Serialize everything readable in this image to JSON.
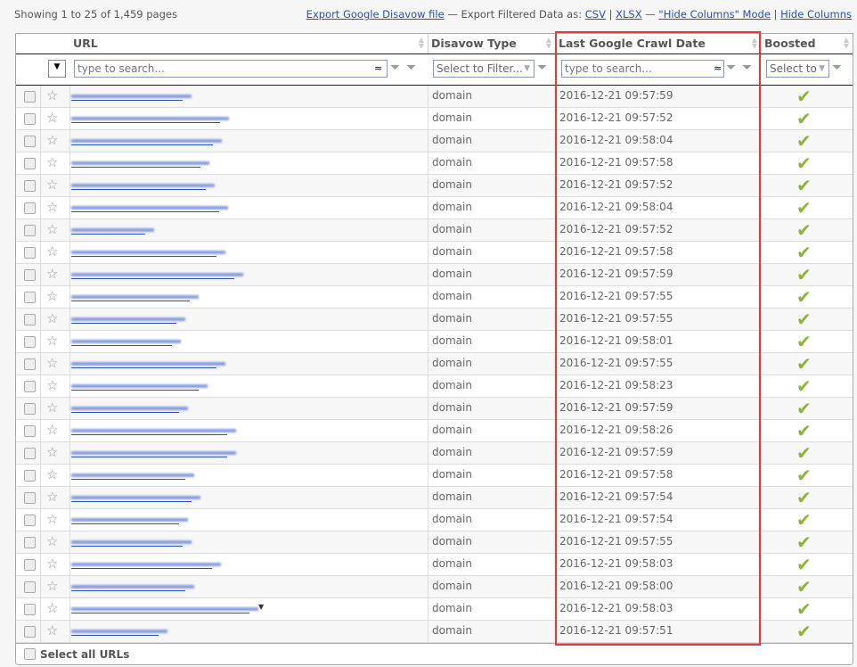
{
  "summary": "Showing 1 to 25 of 1,459 pages",
  "links": {
    "export_disavow": "Export Google Disavow file",
    "sep1": " — Export Filtered Data as: ",
    "csv": "CSV",
    "pipe": " | ",
    "xlsx": "XLSX",
    "sep2": " — ",
    "hide_mode": "\"Hide Columns\" Mode",
    "hide": "Hide Columns"
  },
  "columns": {
    "url": "URL",
    "disavow": "Disavow Type",
    "crawl": "Last Google Crawl Date",
    "boosted": "Boosted"
  },
  "filters": {
    "url_placeholder": "type to search...",
    "disavow_select": "Select to Filter...",
    "crawl_placeholder": "type to search...",
    "boosted_select": "Select to"
  },
  "rows": [
    {
      "type": "domain",
      "date": "2016-12-21 09:57:59"
    },
    {
      "type": "domain",
      "date": "2016-12-21 09:57:52"
    },
    {
      "type": "domain",
      "date": "2016-12-21 09:58:04"
    },
    {
      "type": "domain",
      "date": "2016-12-21 09:57:58"
    },
    {
      "type": "domain",
      "date": "2016-12-21 09:57:52"
    },
    {
      "type": "domain",
      "date": "2016-12-21 09:58:04"
    },
    {
      "type": "domain",
      "date": "2016-12-21 09:57:52"
    },
    {
      "type": "domain",
      "date": "2016-12-21 09:57:58"
    },
    {
      "type": "domain",
      "date": "2016-12-21 09:57:59"
    },
    {
      "type": "domain",
      "date": "2016-12-21 09:57:55"
    },
    {
      "type": "domain",
      "date": "2016-12-21 09:57:55"
    },
    {
      "type": "domain",
      "date": "2016-12-21 09:58:01"
    },
    {
      "type": "domain",
      "date": "2016-12-21 09:57:55"
    },
    {
      "type": "domain",
      "date": "2016-12-21 09:58:23"
    },
    {
      "type": "domain",
      "date": "2016-12-21 09:57:59"
    },
    {
      "type": "domain",
      "date": "2016-12-21 09:58:26"
    },
    {
      "type": "domain",
      "date": "2016-12-21 09:57:59"
    },
    {
      "type": "domain",
      "date": "2016-12-21 09:57:58"
    },
    {
      "type": "domain",
      "date": "2016-12-21 09:57:54"
    },
    {
      "type": "domain",
      "date": "2016-12-21 09:57:54"
    },
    {
      "type": "domain",
      "date": "2016-12-21 09:57:55"
    },
    {
      "type": "domain",
      "date": "2016-12-21 09:58:03"
    },
    {
      "type": "domain",
      "date": "2016-12-21 09:58:00"
    },
    {
      "type": "domain",
      "date": "2016-12-21 09:58:03"
    },
    {
      "type": "domain",
      "date": "2016-12-21 09:57:51"
    }
  ],
  "boosted_icon": "checkmark-icon",
  "footer": {
    "select_all": "Select all URLs"
  },
  "colors": {
    "highlight": "#e0393e",
    "check": "#8db33b",
    "link": "#2a4fb5"
  }
}
